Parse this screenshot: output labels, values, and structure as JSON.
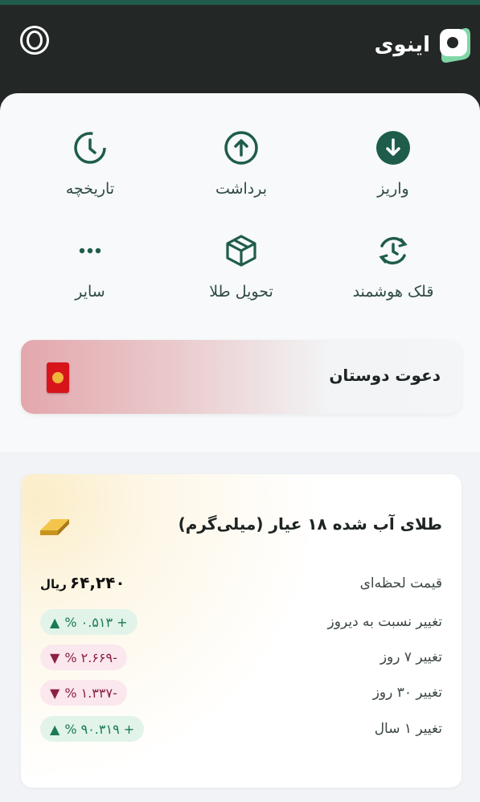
{
  "app": {
    "brand_name": "اینوی",
    "colors": {
      "header": "#232827",
      "accent": "#1f5c4c",
      "up": "#1a7a52",
      "down": "#8b1f46"
    }
  },
  "actions": [
    {
      "label": "واریز",
      "icon": "arrow-down-circle-icon"
    },
    {
      "label": "برداشت",
      "icon": "arrow-up-circle-icon"
    },
    {
      "label": "تاریخچه",
      "icon": "clock-history-icon"
    },
    {
      "label": "قلک هوشمند",
      "icon": "smart-piggy-refresh-icon"
    },
    {
      "label": "تحویل طلا",
      "icon": "package-box-icon"
    },
    {
      "label": "سایر",
      "icon": "more-dots-icon"
    }
  ],
  "invite": {
    "title": "دعوت دوستان",
    "icon": "red-envelope-icon"
  },
  "gold_card": {
    "title": "طلای آب شده ۱۸ عیار (میلی‌گرم)",
    "icon": "gold-bar-icon",
    "price_label": "قیمت لحظه‌ای",
    "price_value": "۶۴,۲۴۰",
    "price_unit": "ریال",
    "changes": [
      {
        "label": "تغییر نسبت به دیروز",
        "value": "% ۰.۵۱۳ +",
        "arrow": "▲",
        "direction": "up"
      },
      {
        "label": "تغییر ۷ روز",
        "value": "% ۲.۶۶۹-",
        "arrow": "▼",
        "direction": "down"
      },
      {
        "label": "تغییر ۳۰ روز",
        "value": "% ۱.۳۳۷-",
        "arrow": "▼",
        "direction": "down"
      },
      {
        "label": "تغییر ۱ سال",
        "value": "% ۹۰.۳۱۹ +",
        "arrow": "▲",
        "direction": "up"
      }
    ]
  }
}
